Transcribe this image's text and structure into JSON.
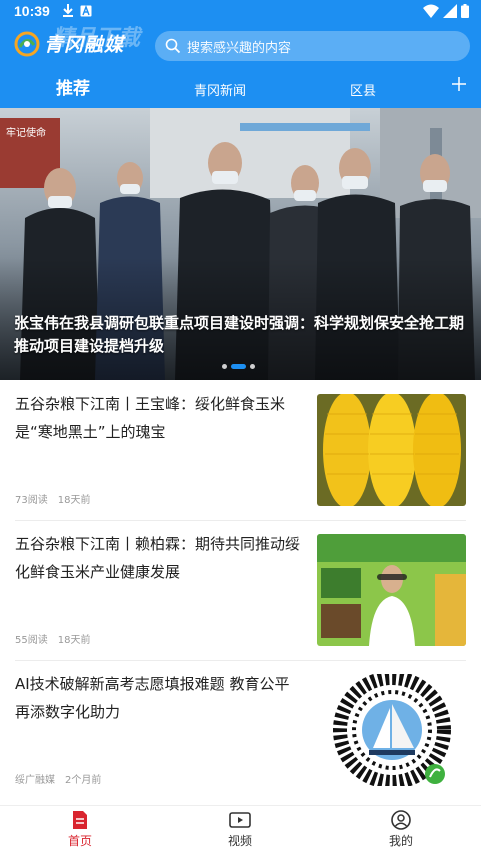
{
  "status_bar": {
    "time": "10:39",
    "left_icons": [
      "download-icon",
      "a-badge-icon"
    ],
    "right_icons": [
      "wifi-icon",
      "signal-icon",
      "battery-icon"
    ]
  },
  "header": {
    "background": "#1d8ff2",
    "logo_text": "青冈融媒",
    "watermark": "精品下载",
    "search": {
      "placeholder": "搜索感兴趣的内容",
      "icon": "search-icon"
    }
  },
  "tabs": [
    {
      "label": "推荐",
      "active": true
    },
    {
      "label": "青冈新闻",
      "active": false
    },
    {
      "label": "区县",
      "active": false
    }
  ],
  "banner": {
    "caption": "张宝伟在我县调研包联重点项目建设时强调：科学规划保安全抢工期 推动项目建设提档升级",
    "dots": 3,
    "active_dot": 1,
    "wall_sign": "牢记使命"
  },
  "news": [
    {
      "title": "五谷杂粮下江南丨王宝峰：绥化鲜食玉米是“寒地黑土”上的瑰宝",
      "reads": "73阅读",
      "time": "18天前",
      "thumb": "corn-photo"
    },
    {
      "title": "五谷杂粮下江南丨赖柏霖：期待共同推动绥化鲜食玉米产业健康发展",
      "reads": "55阅读",
      "time": "18天前",
      "thumb": "interview-photo"
    },
    {
      "title": "AI技术破解新高考志愿填报难题 教育公平再添数字化助力",
      "source": "绥广融媒",
      "time": "2个月前",
      "thumb": "qr-code-image"
    }
  ],
  "bottom_nav": [
    {
      "label": "首页",
      "icon": "home-icon",
      "active": true
    },
    {
      "label": "视频",
      "icon": "video-icon",
      "active": false
    },
    {
      "label": "我的",
      "icon": "profile-icon",
      "active": false
    }
  ],
  "colors": {
    "accent": "#1d8ff2",
    "nav_active": "#d9252f"
  }
}
